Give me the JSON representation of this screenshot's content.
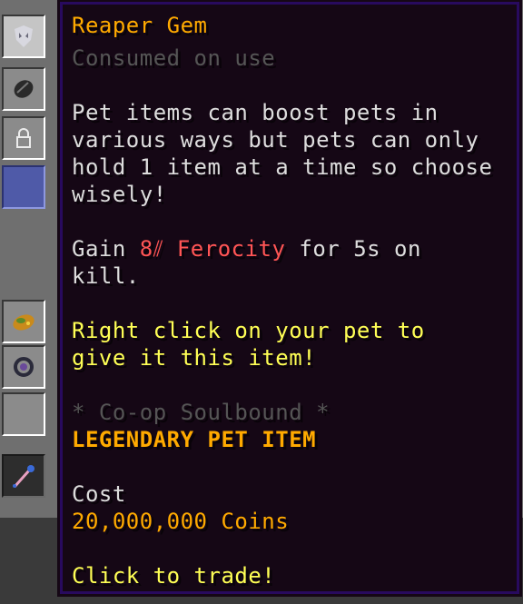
{
  "tooltip": {
    "title": "Reaper Gem",
    "subtitle": "Consumed on use",
    "description": [
      "Pet items can boost pets in",
      "various ways but pets can only",
      "hold 1 item at a time so choose",
      "wisely!"
    ],
    "ability": {
      "prefix": "Gain ",
      "value": "8⫽ Ferocity",
      "suffix": " for 5s on",
      "line2": "kill."
    },
    "instruction": [
      "Right click on your pet to",
      "give it this item!"
    ],
    "soulbound": "* Co-op Soulbound *",
    "rarity": "LEGENDARY PET ITEM",
    "cost_label": "Cost",
    "cost_value": "20,000,000 Coins",
    "action": "Click to trade!"
  },
  "colors": {
    "title": "#ffaa00",
    "subtitle": "#555555",
    "body": "#dddddd",
    "stat": "#ff5555",
    "instruction": "#ffff55",
    "soulbound": "#555555",
    "rarity": "#ffaa00",
    "tooltip_bg": "#150715",
    "tooltip_border": "#280a5e"
  },
  "inventory": {
    "icons": [
      "reaper-gem-icon",
      "coal-item-icon",
      "lock-icon",
      "empty-slot",
      "golden-carrot-icon",
      "ender-ring-icon",
      "empty-slot",
      "wand-icon"
    ]
  }
}
